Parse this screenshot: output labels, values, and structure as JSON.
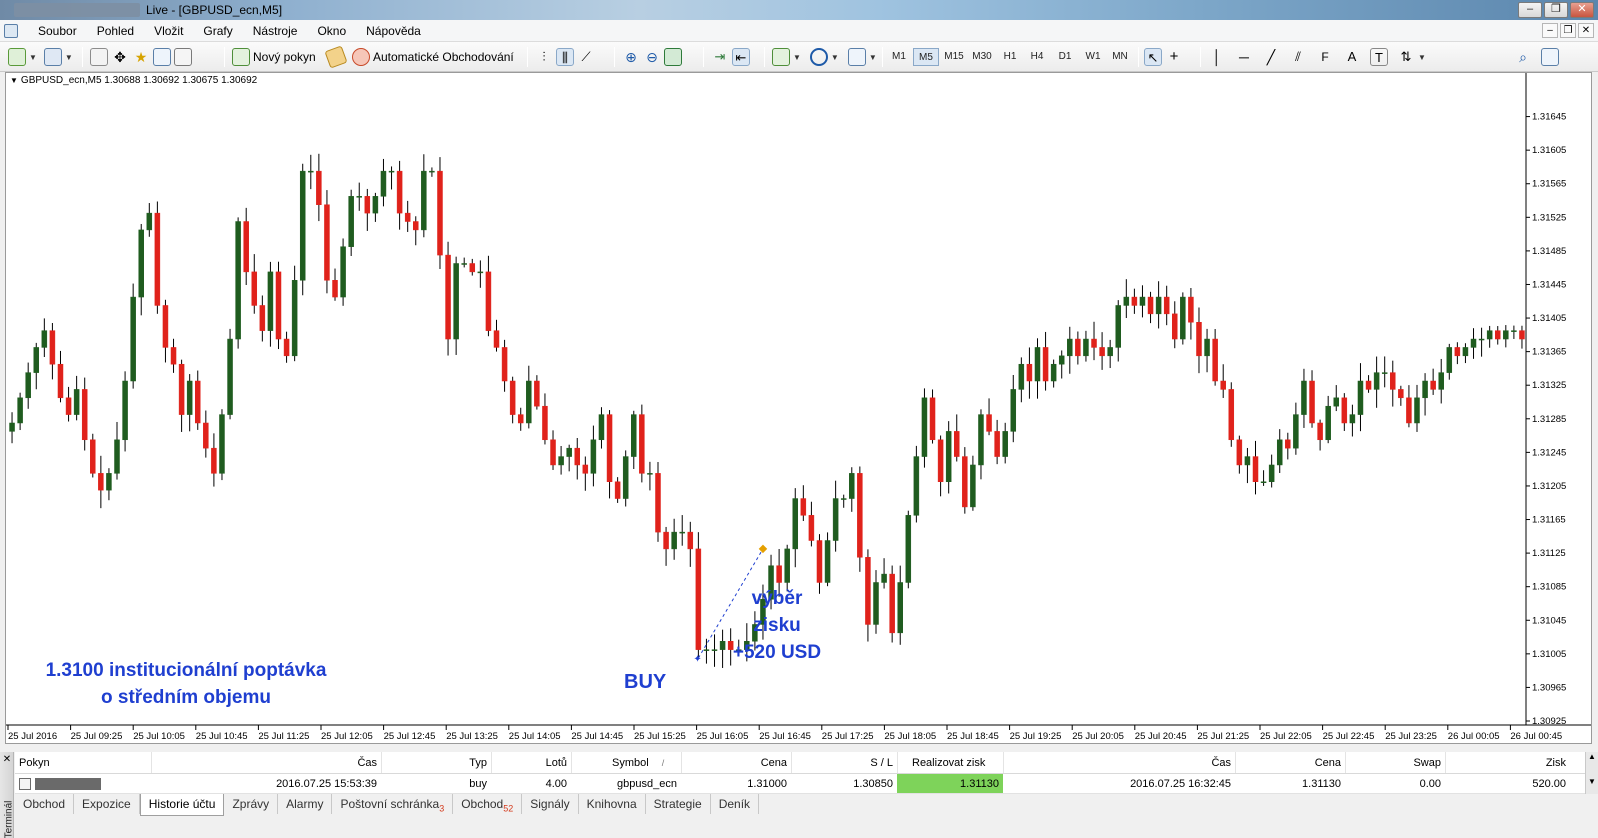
{
  "window": {
    "title": "Live - [GBPUSD_ecn,M5]",
    "buttons": [
      "‒",
      "❐",
      "✕"
    ]
  },
  "menu": [
    "Soubor",
    "Pohled",
    "Vložit",
    "Grafy",
    "Nástroje",
    "Okno",
    "Nápověda"
  ],
  "toolbar": {
    "new_order_label": "Nový pokyn",
    "auto_trading_label": "Automatické Obchodování",
    "timeframes": [
      "M1",
      "M5",
      "M15",
      "M30",
      "H1",
      "H4",
      "D1",
      "W1",
      "MN"
    ],
    "selected_timeframe": "M5"
  },
  "chart": {
    "info_line": "GBPUSD_ecn,M5  1.30688 1.30692 1.30675 1.30692",
    "colors": {
      "bull": "#1f5c1f",
      "bear": "#e0221b",
      "wick": "#000000",
      "background": "#ffffff",
      "annotation": "#1f3fd0"
    },
    "annotations": {
      "left_line1": "1.3100 institucionální poptávka",
      "left_line2": "o středním objemu",
      "buy": "BUY",
      "profit_line1": "výběr",
      "profit_line2": "zisku",
      "profit_line3": "+520 USD"
    }
  },
  "chart_data": {
    "type": "candlestick",
    "symbol": "GBPUSD_ecn",
    "timeframe": "M5",
    "y_tick_labels": [
      "1.31645",
      "1.31605",
      "1.31565",
      "1.31525",
      "1.31485",
      "1.31445",
      "1.31405",
      "1.31365",
      "1.31325",
      "1.31285",
      "1.31245",
      "1.31205",
      "1.31165",
      "1.31125",
      "1.31085",
      "1.31045",
      "1.31005",
      "1.30965",
      "1.30925"
    ],
    "x_tick_labels": [
      "25 Jul 2016",
      "25 Jul 09:25",
      "25 Jul 10:05",
      "25 Jul 10:45",
      "25 Jul 11:25",
      "25 Jul 12:05",
      "25 Jul 12:45",
      "25 Jul 13:25",
      "25 Jul 14:05",
      "25 Jul 14:45",
      "25 Jul 15:25",
      "25 Jul 16:05",
      "25 Jul 16:45",
      "25 Jul 17:25",
      "25 Jul 18:05",
      "25 Jul 18:45",
      "25 Jul 19:25",
      "25 Jul 20:05",
      "25 Jul 20:45",
      "25 Jul 21:25",
      "25 Jul 22:05",
      "25 Jul 22:45",
      "25 Jul 23:25",
      "26 Jul 00:05",
      "26 Jul 00:45"
    ],
    "ylim": [
      1.30925,
      1.31685
    ],
    "candle_close": [
      1.3128,
      1.3131,
      1.3134,
      1.3137,
      1.3139,
      1.3135,
      1.3131,
      1.3129,
      1.3132,
      1.3126,
      1.3122,
      1.312,
      1.3122,
      1.3126,
      1.3133,
      1.3143,
      1.3151,
      1.3153,
      1.3142,
      1.3137,
      1.3135,
      1.3129,
      1.3133,
      1.3128,
      1.3125,
      1.3122,
      1.3129,
      1.3138,
      1.3152,
      1.3146,
      1.3142,
      1.3139,
      1.3146,
      1.3138,
      1.3136,
      1.3145,
      1.3158,
      1.3158,
      1.3154,
      1.3145,
      1.3143,
      1.3149,
      1.3155,
      1.3155,
      1.3153,
      1.3155,
      1.3158,
      1.3158,
      1.3153,
      1.3152,
      1.3151,
      1.3158,
      1.3158,
      1.3148,
      1.3138,
      1.3147,
      1.3147,
      1.3146,
      1.3146,
      1.3139,
      1.3137,
      1.3133,
      1.3129,
      1.3128,
      1.3133,
      1.313,
      1.3126,
      1.3123,
      1.3124,
      1.3125,
      1.3123,
      1.3122,
      1.3126,
      1.3129,
      1.3121,
      1.3119,
      1.3124,
      1.3129,
      1.3122,
      1.3122,
      1.3115,
      1.3113,
      1.3115,
      1.3115,
      1.3113,
      1.3101,
      1.3101,
      1.3101,
      1.3102,
      1.3101,
      1.3101,
      1.3102,
      1.3104,
      1.3107,
      1.3111,
      1.3109,
      1.3113,
      1.3119,
      1.3117,
      1.3114,
      1.3109,
      1.3114,
      1.3119,
      1.3119,
      1.3122,
      1.3112,
      1.3104,
      1.3109,
      1.311,
      1.3103,
      1.3109,
      1.3117,
      1.3124,
      1.3131,
      1.3126,
      1.3121,
      1.3127,
      1.3124,
      1.3118,
      1.3123,
      1.3129,
      1.3127,
      1.3124,
      1.3127,
      1.3132,
      1.3135,
      1.3133,
      1.3137,
      1.3133,
      1.3135,
      1.3136,
      1.3138,
      1.3136,
      1.3138,
      1.3137,
      1.3136,
      1.3137,
      1.3142,
      1.3143,
      1.3142,
      1.3143,
      1.3141,
      1.3143,
      1.3141,
      1.3138,
      1.3143,
      1.314,
      1.3136,
      1.3138,
      1.3133,
      1.3132,
      1.3126,
      1.3123,
      1.3124,
      1.3121,
      1.3121,
      1.3123,
      1.3126,
      1.3125,
      1.3129,
      1.3133,
      1.3128,
      1.3126,
      1.313,
      1.3131,
      1.3128,
      1.3129,
      1.3133,
      1.3132,
      1.3134,
      1.3134,
      1.3132,
      1.3131,
      1.3128,
      1.3131,
      1.3133,
      1.3132,
      1.3134,
      1.3137,
      1.3136,
      1.3137,
      1.3138,
      1.3138,
      1.3139,
      1.3138,
      1.3139,
      1.3139,
      1.3138
    ],
    "candles_note": "OHLC series approximated from visual; open/high/low derived in script"
  },
  "terminal": {
    "side_label": "Terminál",
    "headers": [
      "Pokyn",
      "Čas",
      "Typ",
      "Lotů",
      "Symbol",
      "Cena",
      "S / L",
      "Realizovat zisk",
      "Čas",
      "Cena",
      "Swap",
      "Zisk"
    ],
    "sort_marker": "/",
    "row": {
      "order": "",
      "open_time": "2016.07.25 15:53:39",
      "type": "buy",
      "lots": "4.00",
      "symbol": "gbpusd_ecn",
      "price": "1.31000",
      "sl": "1.30850",
      "tp": "1.31130",
      "close_time": "2016.07.25 16:32:45",
      "close_price": "1.31130",
      "swap": "0.00",
      "profit": "520.00"
    },
    "tabs": [
      {
        "label": "Obchod"
      },
      {
        "label": "Expozice"
      },
      {
        "label": "Historie účtu",
        "active": true
      },
      {
        "label": "Zprávy"
      },
      {
        "label": "Alarmy"
      },
      {
        "label": "Poštovní schránka",
        "badge": "3"
      },
      {
        "label": "Obchod",
        "badge": "52"
      },
      {
        "label": "Signály"
      },
      {
        "label": "Knihovna"
      },
      {
        "label": "Strategie"
      },
      {
        "label": "Deník"
      }
    ]
  }
}
